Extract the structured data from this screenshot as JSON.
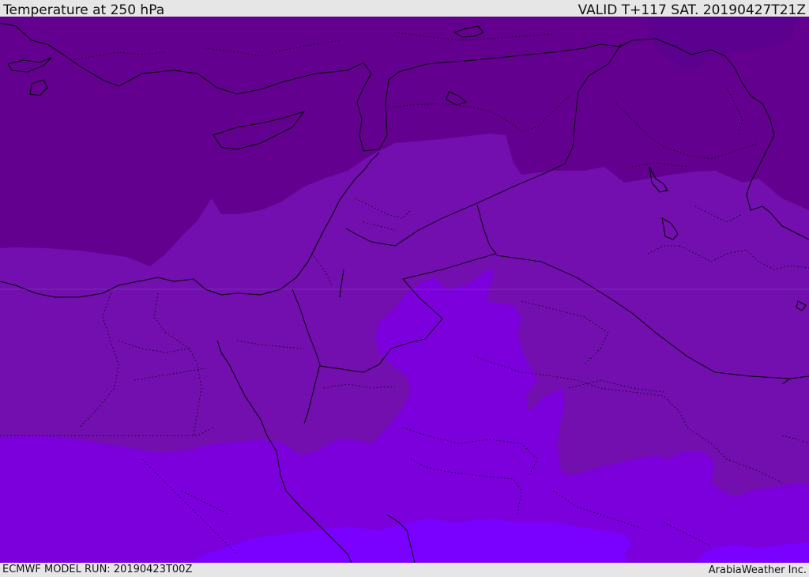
{
  "header": {
    "title": "Temperature at 250 hPa",
    "valid": "VALID T+117 SAT. 20190427T21Z"
  },
  "footer": {
    "model_run": "ECMWF MODEL RUN: 20190423T00Z",
    "credit": "ArabiaWeather Inc."
  },
  "map": {
    "colors": {
      "band_coldest": "#5c0090",
      "band_cold": "#64008f",
      "band_mid": "#720fae",
      "band_warm": "#7c00dc",
      "band_warmest": "#7a00ff",
      "coastline": "#000000",
      "border": "#000000"
    }
  }
}
